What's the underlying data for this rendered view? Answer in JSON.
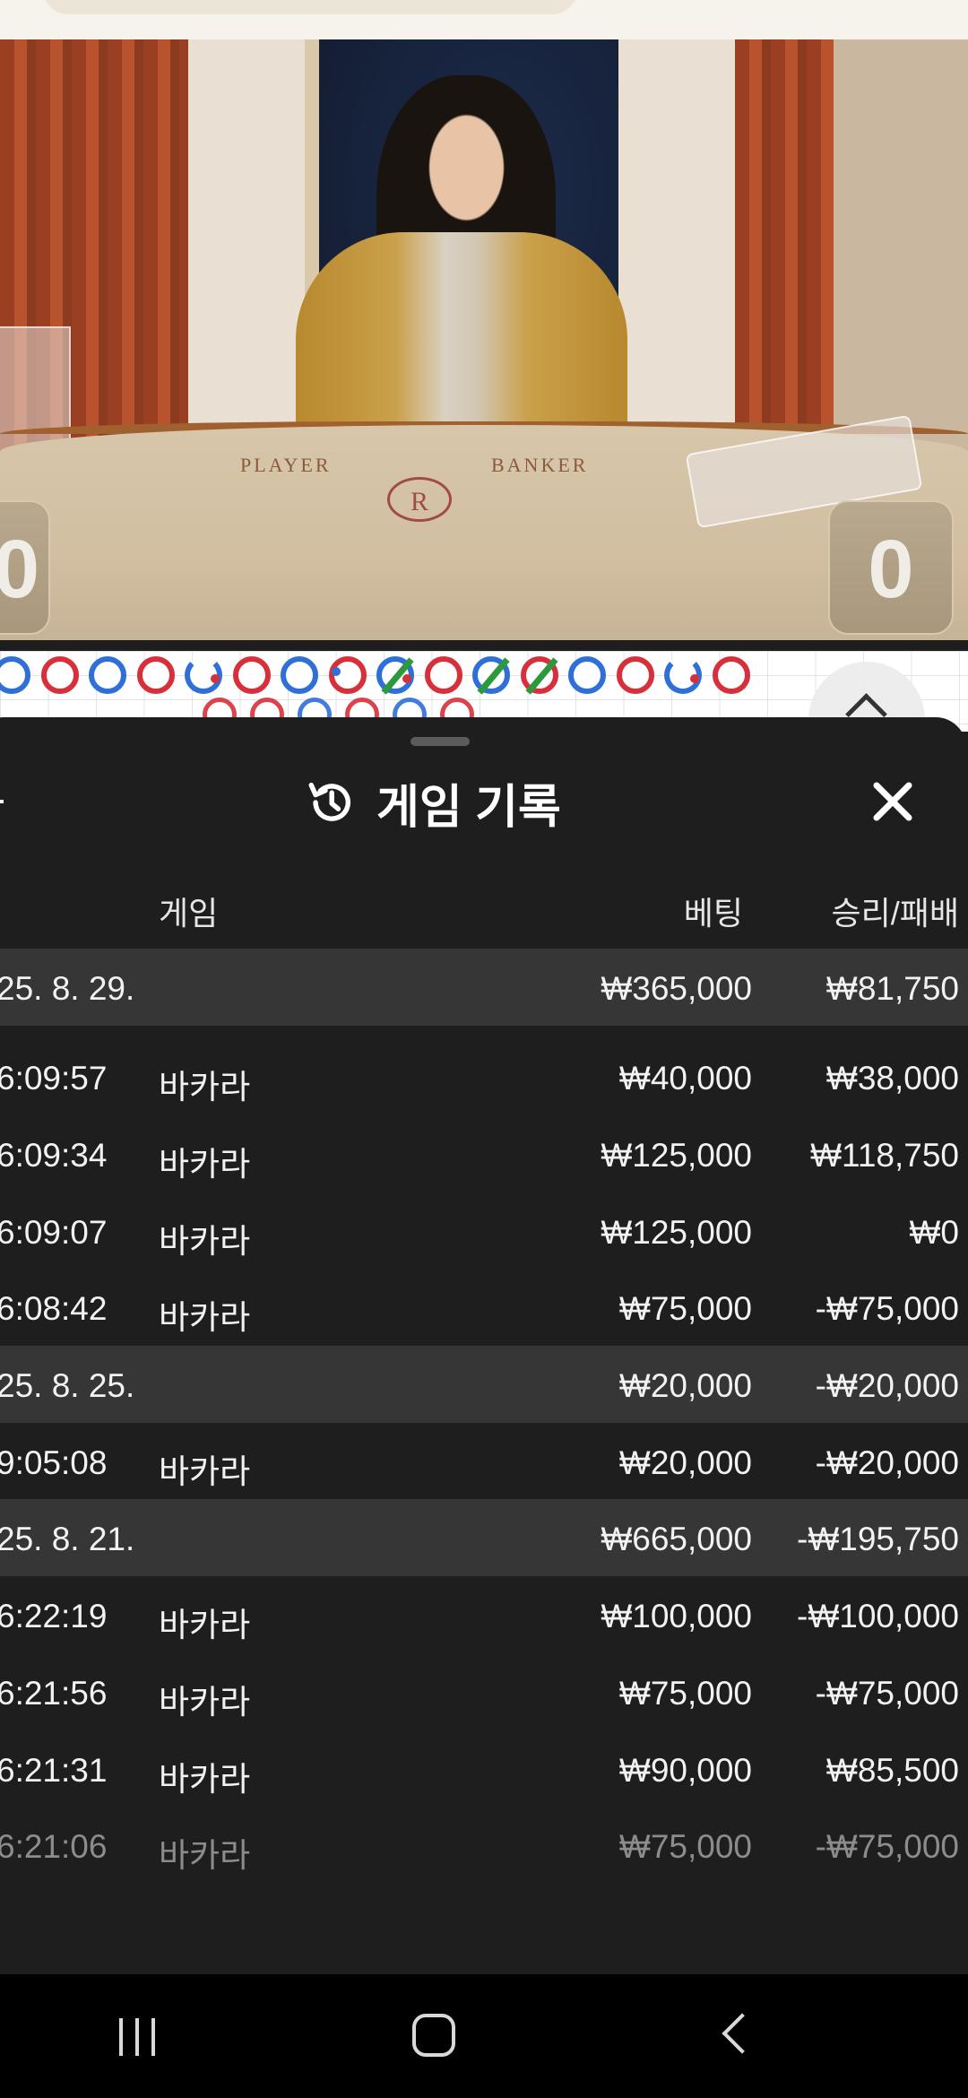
{
  "video": {
    "table_left_label": "PLAYER",
    "table_right_label": "BANKER",
    "table_logo": "R",
    "player_score": "0",
    "banker_score": "0"
  },
  "history": {
    "title": "게임 기록",
    "icon": "history-icon",
    "close_icon": "close-icon",
    "columns": {
      "game": "게임",
      "bet": "베팅",
      "winloss": "승리/패배"
    },
    "rows": [
      {
        "type": "date",
        "time": "25. 8. 29.",
        "game": "",
        "bet": "₩365,000",
        "winloss": "₩81,750"
      },
      {
        "type": "item",
        "time": "6:09:57",
        "game": "바카라",
        "bet": "₩40,000",
        "winloss": "₩38,000"
      },
      {
        "type": "item",
        "time": "6:09:34",
        "game": "바카라",
        "bet": "₩125,000",
        "winloss": "₩118,750"
      },
      {
        "type": "item",
        "time": "6:09:07",
        "game": "바카라",
        "bet": "₩125,000",
        "winloss": "₩0"
      },
      {
        "type": "item",
        "time": "6:08:42",
        "game": "바카라",
        "bet": "₩75,000",
        "winloss": "-₩75,000"
      },
      {
        "type": "date",
        "time": "25. 8. 25.",
        "game": "",
        "bet": "₩20,000",
        "winloss": "-₩20,000"
      },
      {
        "type": "item",
        "time": "9:05:08",
        "game": "바카라",
        "bet": "₩20,000",
        "winloss": "-₩20,000"
      },
      {
        "type": "date",
        "time": "25. 8. 21.",
        "game": "",
        "bet": "₩665,000",
        "winloss": "-₩195,750"
      },
      {
        "type": "item",
        "time": "6:22:19",
        "game": "바카라",
        "bet": "₩100,000",
        "winloss": "-₩100,000"
      },
      {
        "type": "item",
        "time": "6:21:56",
        "game": "바카라",
        "bet": "₩75,000",
        "winloss": "-₩75,000"
      },
      {
        "type": "item",
        "time": "6:21:31",
        "game": "바카라",
        "bet": "₩90,000",
        "winloss": "₩85,500"
      },
      {
        "type": "item",
        "time": "6:21:06",
        "game": "바카라",
        "bet": "₩75,000",
        "winloss": "-₩75,000"
      }
    ]
  },
  "colors": {
    "sheet_bg": "#1e1e1e",
    "date_row_bg": "#363636",
    "roadmap_red": "#d8303a",
    "roadmap_blue": "#2f6fd8",
    "roadmap_tie": "#2c9a3c"
  },
  "navbar": {
    "recents_icon": "recents-icon",
    "home_icon": "home-icon",
    "back_icon": "back-icon"
  }
}
